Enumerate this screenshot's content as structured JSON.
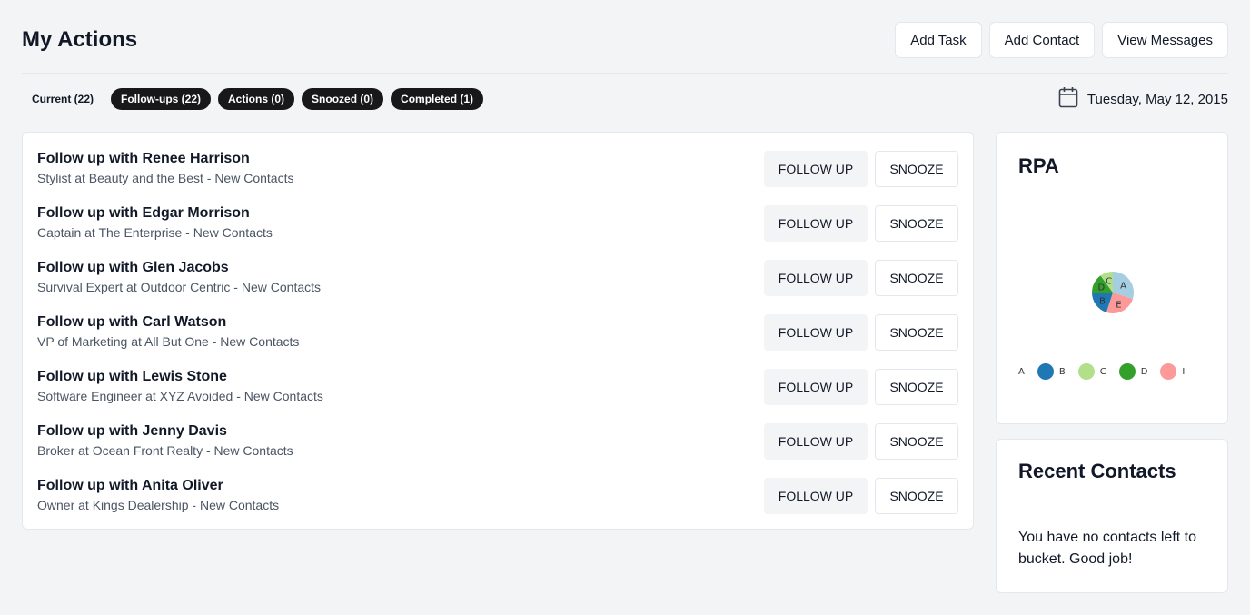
{
  "header": {
    "title": "My Actions",
    "buttons": {
      "add_task": "Add Task",
      "add_contact": "Add Contact",
      "view_messages": "View Messages"
    }
  },
  "filters": [
    {
      "label": "Current (22)",
      "style": "plain"
    },
    {
      "label": "Follow-ups (22)",
      "style": "dark"
    },
    {
      "label": "Actions (0)",
      "style": "dark"
    },
    {
      "label": "Snoozed (0)",
      "style": "dark"
    },
    {
      "label": "Completed (1)",
      "style": "dark"
    }
  ],
  "date": {
    "text": "Tuesday, May 12, 2015",
    "icon": "calendar-icon"
  },
  "actions": {
    "follow_up_label": "FOLLOW UP",
    "snooze_label": "SNOOZE",
    "items": [
      {
        "title": "Follow up with Renee Harrison",
        "subtitle": "Stylist at Beauty and the Best - New Contacts"
      },
      {
        "title": "Follow up with Edgar Morrison",
        "subtitle": "Captain at The Enterprise - New Contacts"
      },
      {
        "title": "Follow up with Glen Jacobs",
        "subtitle": "Survival Expert at Outdoor Centric - New Contacts"
      },
      {
        "title": "Follow up with Carl Watson",
        "subtitle": "VP of Marketing at All But One - New Contacts"
      },
      {
        "title": "Follow up with Lewis Stone",
        "subtitle": "Software Engineer at XYZ Avoided - New Contacts"
      },
      {
        "title": "Follow up with Jenny Davis",
        "subtitle": "Broker at Ocean Front Realty - New Contacts"
      },
      {
        "title": "Follow up with Anita Oliver",
        "subtitle": "Owner at Kings Dealership - New Contacts"
      }
    ]
  },
  "rpa": {
    "title": "RPA",
    "legend_labels": [
      "A",
      "B",
      "C",
      "D",
      "I"
    ]
  },
  "chart_data": {
    "type": "pie",
    "title": "RPA",
    "slices": [
      {
        "label": "A",
        "value": 30,
        "color": "#a6cee3"
      },
      {
        "label": "E",
        "value": 25,
        "color": "#fb9a99"
      },
      {
        "label": "B",
        "value": 20,
        "color": "#1f78b4"
      },
      {
        "label": "D",
        "value": 15,
        "color": "#33a02c"
      },
      {
        "label": "C",
        "value": 10,
        "color": "#b2df8a"
      }
    ],
    "legend": [
      {
        "label": "A",
        "color": "#a6cee3"
      },
      {
        "label": "B",
        "color": "#1f78b4"
      },
      {
        "label": "C",
        "color": "#b2df8a"
      },
      {
        "label": "D",
        "color": "#33a02c"
      },
      {
        "label": "I",
        "color": "#fb9a99"
      }
    ],
    "legend_placement": "bottom"
  },
  "recent_contacts": {
    "title": "Recent Contacts",
    "message": "You have no contacts left to bucket. Good job!"
  }
}
